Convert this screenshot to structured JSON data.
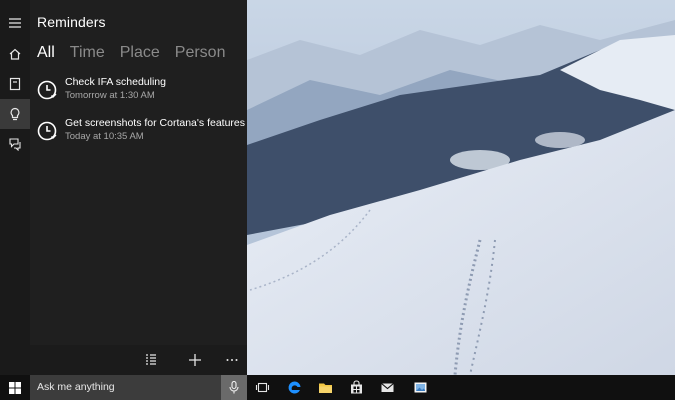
{
  "cortana": {
    "title": "Reminders",
    "tabs": [
      {
        "label": "All",
        "active": true
      },
      {
        "label": "Time",
        "active": false
      },
      {
        "label": "Place",
        "active": false
      },
      {
        "label": "Person",
        "active": false
      }
    ],
    "reminders": [
      {
        "title": "Check IFA scheduling",
        "time": "Tomorrow at 1:30 AM"
      },
      {
        "title": "Get screenshots for Cortana's features",
        "time": "Today at 10:35 AM"
      }
    ],
    "rail_icons": [
      "hamburger-menu-icon",
      "home-icon",
      "notebook-icon",
      "reminders-lightbulb-icon",
      "feedback-icon"
    ],
    "bottom_bar_icons": [
      "list-view-icon",
      "add-icon",
      "more-icon"
    ]
  },
  "taskbar": {
    "search_placeholder": "Ask me anything",
    "icons": [
      "windows-start-icon",
      "microphone-icon",
      "task-view-icon",
      "edge-browser-icon",
      "file-explorer-icon",
      "store-icon",
      "mail-icon",
      "photos-icon"
    ]
  },
  "colors": {
    "panel_bg": "#1f1f1f",
    "rail_bg": "#1a1a1a",
    "taskbar_bg": "#101010",
    "search_bg": "#3c3c3c",
    "edge_blue": "#1e90ff",
    "folder_yellow": "#f2c744"
  }
}
